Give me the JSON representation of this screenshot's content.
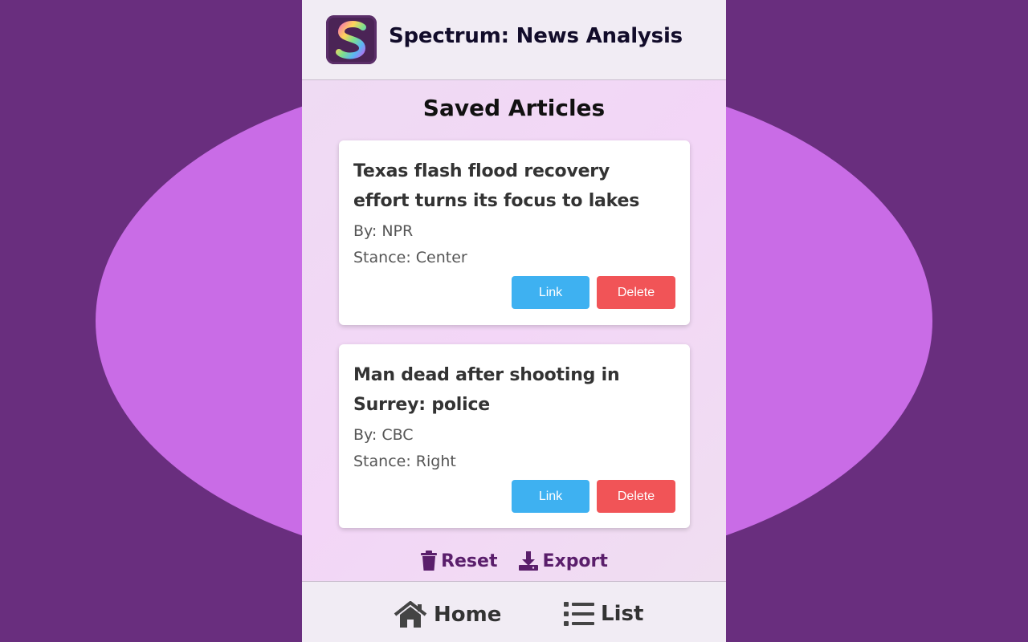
{
  "app": {
    "title": "Spectrum: News Analysis",
    "logo_letter": "S"
  },
  "section": {
    "title": "Saved Articles"
  },
  "articles": [
    {
      "title": "Texas flash flood recovery effort turns its focus to lakes",
      "by": "By: NPR",
      "stance": "Stance: Center",
      "link_label": "Link",
      "delete_label": "Delete"
    },
    {
      "title": "Man dead after shooting in Surrey: police",
      "by": "By: CBC",
      "stance": "Stance: Right",
      "link_label": "Link",
      "delete_label": "Delete"
    }
  ],
  "toolbar": {
    "reset_label": "Reset",
    "export_label": "Export",
    "reset_icon": "trash-icon",
    "export_icon": "download-icon"
  },
  "nav": {
    "home_label": "Home",
    "list_label": "List",
    "home_icon": "home-icon",
    "list_icon": "list-icon"
  },
  "colors": {
    "background": "#692e7e",
    "ellipse": "#c96ce6",
    "link_button": "#3eb1f1",
    "delete_button": "#f15457",
    "toolbar_text": "#5a1e6b"
  }
}
